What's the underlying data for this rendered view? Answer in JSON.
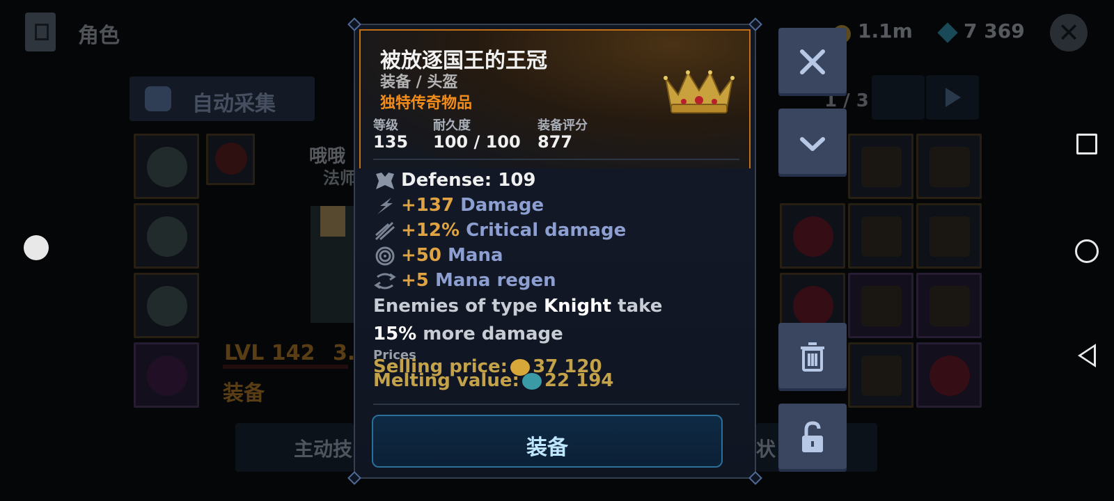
{
  "background": {
    "page_title": "角色",
    "gold": "1.1m",
    "gems": "7 369",
    "auto_collect_label": "自动采集",
    "hero_name": "哦哦",
    "hero_class": "法师",
    "level": "LVL 142",
    "level_value": "3.",
    "equip_tab": "装备",
    "active_skills_label": "主动技",
    "status_label": "状",
    "page_indicator": "1 / 3"
  },
  "item": {
    "name": "被放逐国王的王冠",
    "type": "装备 / 头盔",
    "rarity": "独特传奇物品",
    "icon": "crown-icon",
    "stats": [
      {
        "label": "等级",
        "value": "135"
      },
      {
        "label": "耐久度",
        "value": "100 / 100"
      },
      {
        "label": "装备评分",
        "value": "877"
      }
    ],
    "defense": "Defense: 109",
    "bonuses": [
      {
        "icon": "damage-icon",
        "value": "+137",
        "label": "Damage"
      },
      {
        "icon": "critical-damage-icon",
        "value": "+12%",
        "label": "Critical damage"
      },
      {
        "icon": "mana-icon",
        "value": "+50",
        "label": "Mana"
      },
      {
        "icon": "mana-regen-icon",
        "value": "+5",
        "label": "Mana regen"
      }
    ],
    "effect": {
      "prefix": "Enemies of type ",
      "enemy": "Knight",
      "middle": " take ",
      "percent": "15%",
      "suffix": " more damage"
    },
    "prices_heading": "Prices",
    "selling_label": "Selling price:",
    "selling_value": "37 120",
    "melting_label": "Melting value:",
    "melting_value": "22 194",
    "equip_button": "装备"
  },
  "colors": {
    "rarity_orange": "#f28d1b",
    "stat_number": "#e0a341",
    "stat_label": "#8c9fd0",
    "price_gold": "#c4a24a",
    "panel_border": "#c46f16",
    "button_border": "#2b6f9c"
  }
}
